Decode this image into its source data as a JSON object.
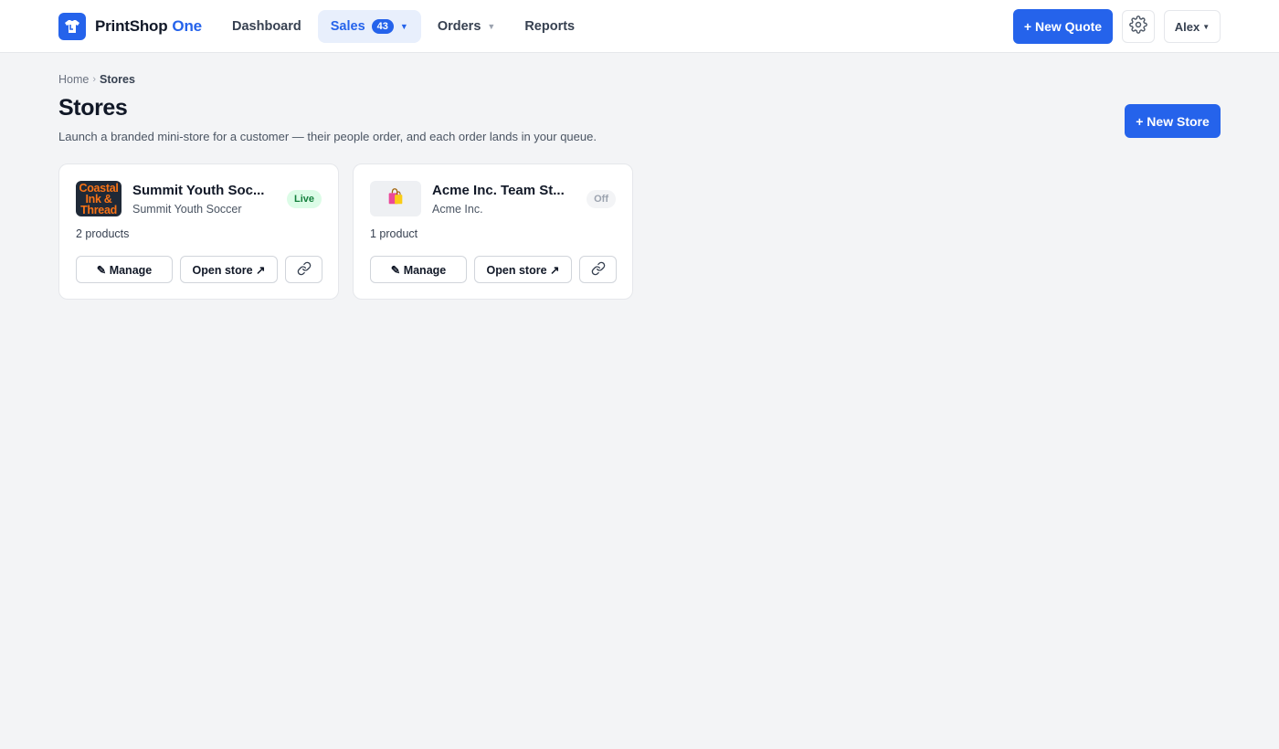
{
  "brand": {
    "name": "PrintShop",
    "accent": "One",
    "icon": "t-shirt-icon",
    "color": "#2563eb"
  },
  "nav": {
    "items": [
      {
        "label": "Dashboard"
      },
      {
        "label": "Sales",
        "badge": "43",
        "has_dropdown": true,
        "active": true
      },
      {
        "label": "Orders",
        "has_dropdown": true
      },
      {
        "label": "Reports"
      }
    ]
  },
  "header": {
    "new_quote_label": "+ New Quote",
    "settings_icon": "gear-icon",
    "user_label": "Alex"
  },
  "breadcrumb": {
    "home": "Home",
    "separator": "›",
    "current": "Stores"
  },
  "page": {
    "title": "Stores",
    "subtitle": "Launch a branded mini-store for a customer — their people order, and each order lands in your queue.",
    "new_store_label": "+ New Store"
  },
  "stores": [
    {
      "name": "Summit Youth Soc...",
      "customer": "Summit Youth Soccer",
      "status": "Live",
      "products": "2 products",
      "logo_lines": [
        "Coastal",
        "Ink &",
        "Thread"
      ],
      "manage_label": "✎ Manage",
      "open_label": "Open store ↗",
      "link_icon": "link-icon"
    },
    {
      "name": "Acme Inc. Team St...",
      "customer": "Acme Inc.",
      "status": "Off",
      "products": "1 product",
      "logo_icon": "shopping-bags-icon",
      "manage_label": "✎ Manage",
      "open_label": "Open store ↗",
      "link_icon": "link-icon"
    }
  ],
  "colors": {
    "accent": "#2563eb",
    "live_bg": "#dcfce7",
    "live_text": "#15803d",
    "off_bg": "#f3f4f6",
    "off_text": "#9ca3af",
    "page_bg": "#f3f4f6"
  }
}
